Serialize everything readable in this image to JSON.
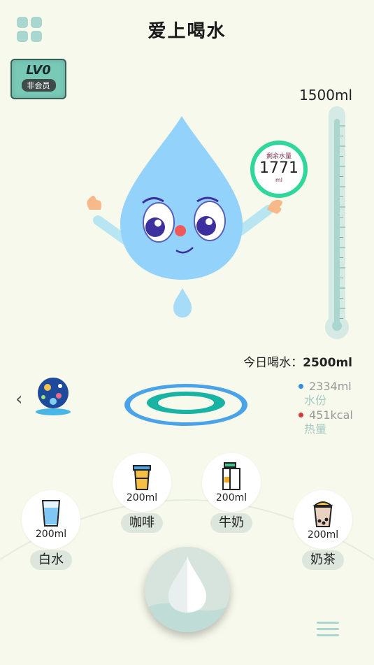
{
  "app": {
    "title": "爱上喝水"
  },
  "level": {
    "label": "LV0",
    "member": "非会员"
  },
  "tube": {
    "capacity": "1500ml"
  },
  "remaining": {
    "label": "剩余水量",
    "value": "1771",
    "unit": "ml"
  },
  "today": {
    "label": "今日喝水：",
    "value": "2500ml"
  },
  "stats": {
    "water": {
      "value": "2334ml",
      "label": "水份",
      "color": "#2f8fe6"
    },
    "calories": {
      "value": "451kcal",
      "label": "热量",
      "color": "#d83a3a"
    }
  },
  "drinks": [
    {
      "name": "白水",
      "amount": "200ml",
      "icon": "water-glass-icon"
    },
    {
      "name": "咖啡",
      "amount": "200ml",
      "icon": "coffee-cup-icon"
    },
    {
      "name": "牛奶",
      "amount": "200ml",
      "icon": "milk-carton-icon"
    },
    {
      "name": "奶茶",
      "amount": "200ml",
      "icon": "bubble-tea-icon"
    }
  ],
  "colors": {
    "background": "#f7f9ec",
    "accent": "#a9d6cf",
    "water": "#8fd0f7",
    "ring_outer": "#4aa3e8",
    "ring_inner": "#19b3a3"
  }
}
